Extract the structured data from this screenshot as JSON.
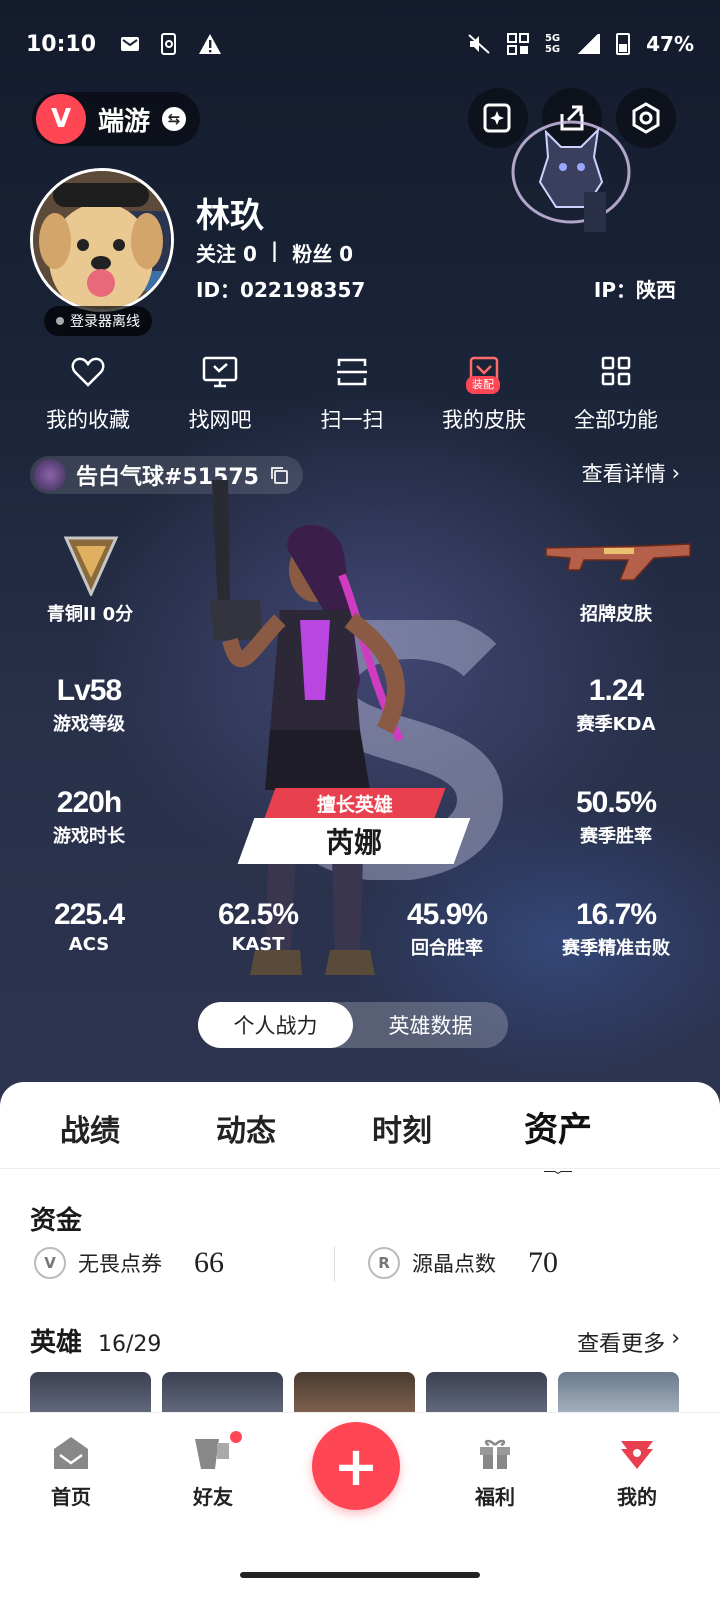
{
  "status_bar": {
    "time": "10:10",
    "network": "5G",
    "battery": "47%"
  },
  "header": {
    "game_name": "端游",
    "game_logo": "V",
    "icons": [
      "sparkle-icon",
      "share-icon",
      "settings-icon"
    ]
  },
  "profile": {
    "name": "林玖",
    "follow_label": "关注 0",
    "fans_label": "粉丝 0",
    "separator": "|",
    "id_text": "ID：022198357",
    "ip_text": "IP：陕西",
    "launcher_status": "登录器离线"
  },
  "quick_actions": [
    {
      "label": "我的收藏",
      "icon": "heart-icon"
    },
    {
      "label": "找网吧",
      "icon": "monitor-icon"
    },
    {
      "label": "扫一扫",
      "icon": "scan-icon"
    },
    {
      "label": "我的皮肤",
      "icon": "skin-icon",
      "badge": "装配"
    },
    {
      "label": "全部功能",
      "icon": "grid-icon"
    }
  ],
  "riot": {
    "id": "告白气球#51575",
    "detail_link": "查看详情"
  },
  "stats": {
    "rank": "青铜II 0分",
    "skin": "招牌皮肤",
    "level_value": "Lv58",
    "level_label": "游戏等级",
    "kda_value": "1.24",
    "kda_label": "赛季KDA",
    "time_value": "220h",
    "time_label": "游戏时长",
    "winrate_value": "50.5%",
    "winrate_label": "赛季胜率",
    "acs_value": "225.4",
    "acs_label": "ACS",
    "kast_value": "62.5%",
    "kast_label": "KAST",
    "round_value": "45.9%",
    "round_label": "回合胜率",
    "precise_value": "16.7%",
    "precise_label": "赛季精准击败"
  },
  "agent": {
    "tag": "擅长英雄",
    "name": "芮娜"
  },
  "segment": {
    "options": [
      "个人战力",
      "英雄数据"
    ],
    "selected": "个人战力"
  },
  "tabs": {
    "items": [
      "战绩",
      "动态",
      "时刻",
      "资产"
    ],
    "active": "资产"
  },
  "funds": {
    "title": "资金",
    "items": [
      {
        "label": "无畏点券",
        "value": "66",
        "icon": "V"
      },
      {
        "label": "源晶点数",
        "value": "70",
        "icon": "R"
      }
    ]
  },
  "heroes": {
    "title": "英雄",
    "count": "16/29",
    "more": "查看更多"
  },
  "bottom_nav": {
    "items": [
      "首页",
      "好友",
      "福利",
      "我的"
    ],
    "fab": "+"
  },
  "colors": {
    "accent": "#ff4655",
    "panel_bg": "#ffffff",
    "hero_bg": "#1b2438"
  }
}
